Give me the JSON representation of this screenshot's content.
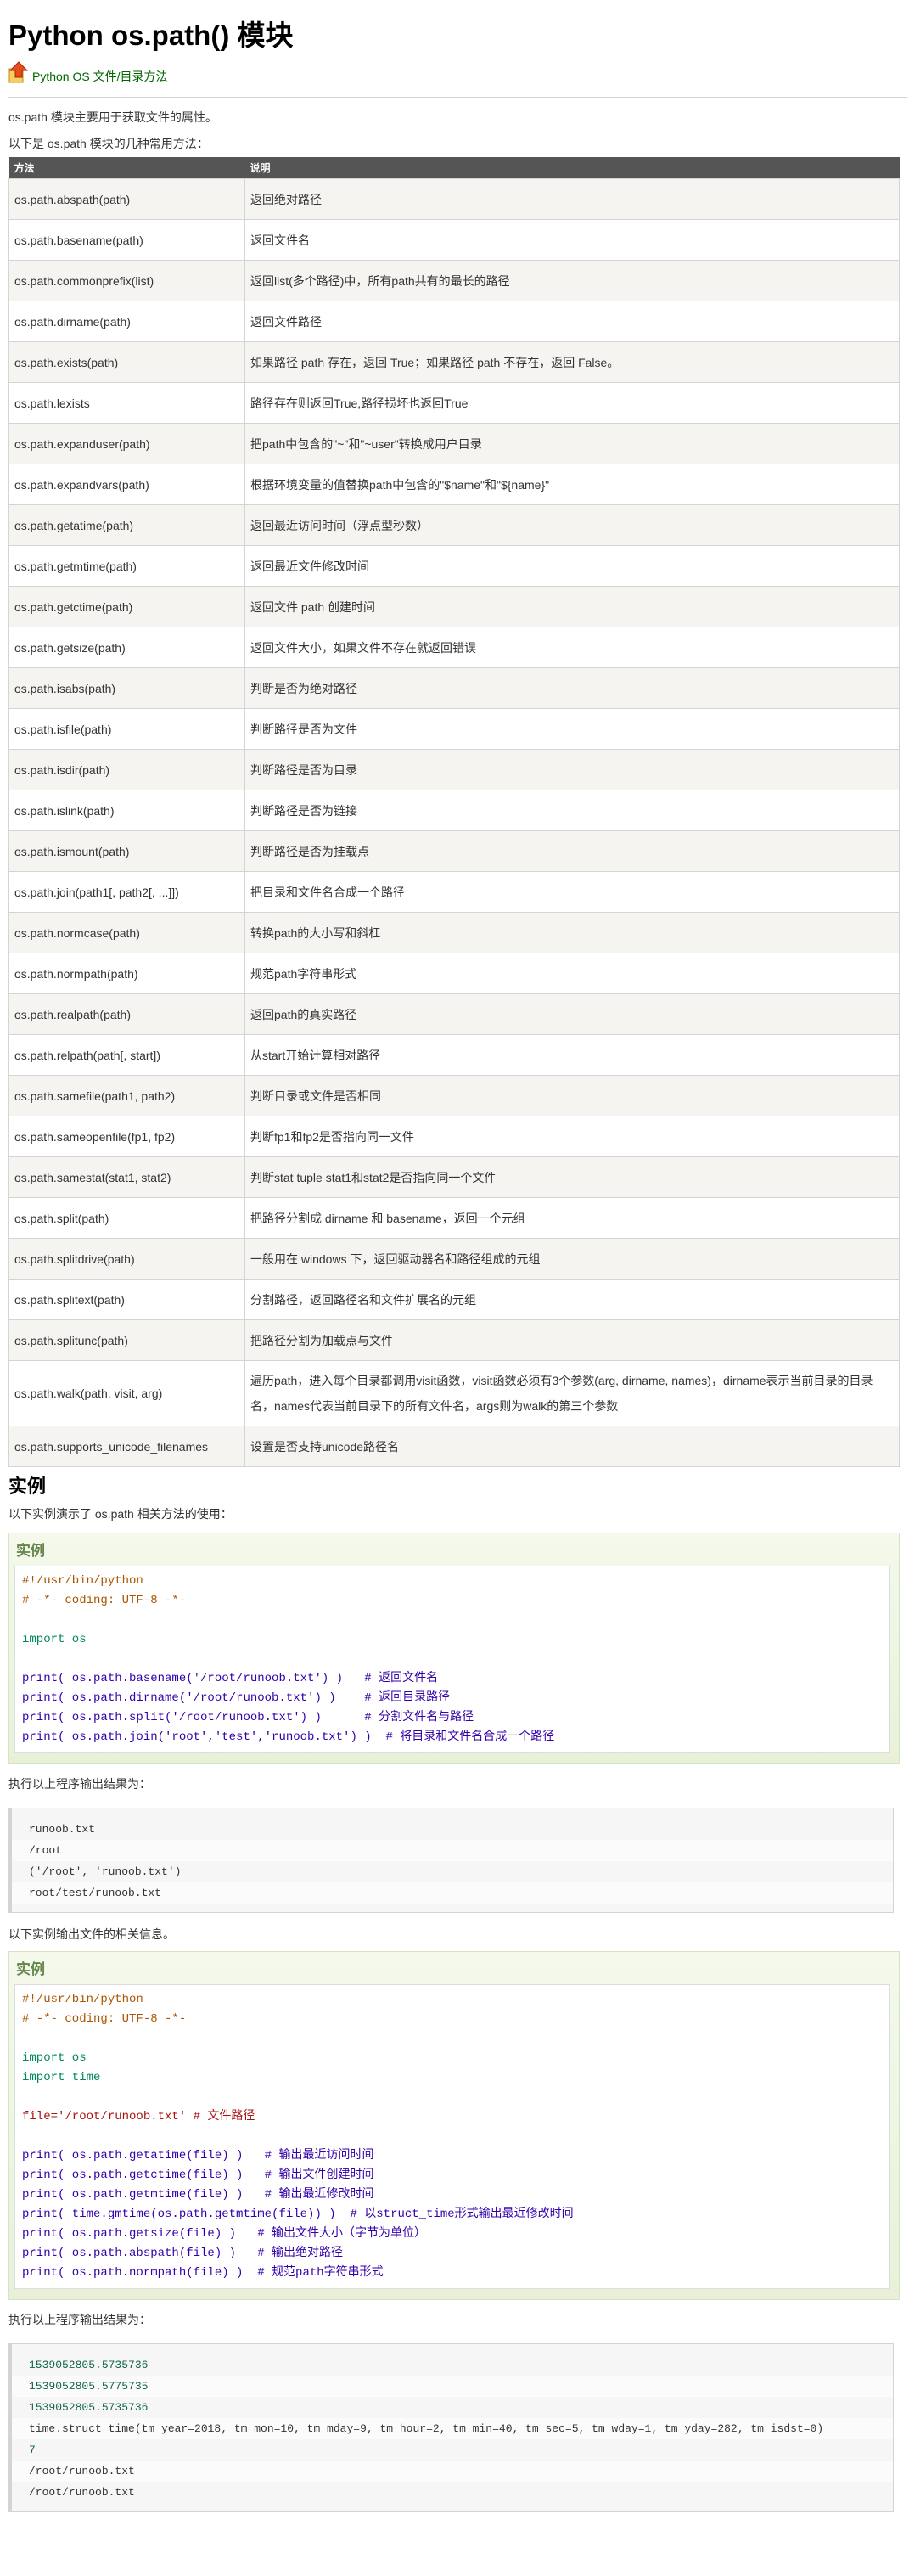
{
  "title": "Python os.path() 模块",
  "back_link": "Python OS 文件/目录方法",
  "intro1": "os.path 模块主要用于获取文件的属性。",
  "intro2": "以下是 os.path 模块的几种常用方法：",
  "table": {
    "headers": [
      "方法",
      "说明"
    ],
    "rows": [
      [
        "os.path.abspath(path)",
        "返回绝对路径"
      ],
      [
        "os.path.basename(path)",
        "返回文件名"
      ],
      [
        "os.path.commonprefix(list)",
        "返回list(多个路径)中，所有path共有的最长的路径"
      ],
      [
        "os.path.dirname(path)",
        "返回文件路径"
      ],
      [
        "os.path.exists(path)",
        "如果路径 path 存在，返回 True；如果路径 path 不存在，返回 False。"
      ],
      [
        "os.path.lexists",
        "路径存在则返回True,路径损坏也返回True"
      ],
      [
        "os.path.expanduser(path)",
        "把path中包含的\"~\"和\"~user\"转换成用户目录"
      ],
      [
        "os.path.expandvars(path)",
        "根据环境变量的值替换path中包含的\"$name\"和\"${name}\""
      ],
      [
        "os.path.getatime(path)",
        "返回最近访问时间（浮点型秒数）"
      ],
      [
        "os.path.getmtime(path)",
        "返回最近文件修改时间"
      ],
      [
        "os.path.getctime(path)",
        "返回文件 path 创建时间"
      ],
      [
        "os.path.getsize(path)",
        "返回文件大小，如果文件不存在就返回错误"
      ],
      [
        "os.path.isabs(path)",
        "判断是否为绝对路径"
      ],
      [
        "os.path.isfile(path)",
        "判断路径是否为文件"
      ],
      [
        "os.path.isdir(path)",
        "判断路径是否为目录"
      ],
      [
        "os.path.islink(path)",
        "判断路径是否为链接"
      ],
      [
        "os.path.ismount(path)",
        "判断路径是否为挂载点"
      ],
      [
        "os.path.join(path1[, path2[, ...]])",
        "把目录和文件名合成一个路径"
      ],
      [
        "os.path.normcase(path)",
        "转换path的大小写和斜杠"
      ],
      [
        "os.path.normpath(path)",
        "规范path字符串形式"
      ],
      [
        "os.path.realpath(path)",
        "返回path的真实路径"
      ],
      [
        "os.path.relpath(path[, start])",
        "从start开始计算相对路径"
      ],
      [
        "os.path.samefile(path1, path2)",
        "判断目录或文件是否相同"
      ],
      [
        "os.path.sameopenfile(fp1, fp2)",
        "判断fp1和fp2是否指向同一文件"
      ],
      [
        "os.path.samestat(stat1, stat2)",
        "判断stat tuple stat1和stat2是否指向同一个文件"
      ],
      [
        "os.path.split(path)",
        "把路径分割成 dirname 和 basename，返回一个元组"
      ],
      [
        "os.path.splitdrive(path)",
        "一般用在 windows 下，返回驱动器名和路径组成的元组"
      ],
      [
        "os.path.splitext(path)",
        "分割路径，返回路径名和文件扩展名的元组"
      ],
      [
        "os.path.splitunc(path)",
        "把路径分割为加载点与文件"
      ],
      [
        "os.path.walk(path, visit, arg)",
        "遍历path，进入每个目录都调用visit函数，visit函数必须有3个参数(arg, dirname, names)，dirname表示当前目录的目录名，names代表当前目录下的所有文件名，args则为walk的第三个参数"
      ],
      [
        "os.path.supports_unicode_filenames",
        "设置是否支持unicode路径名"
      ]
    ]
  },
  "section_title": "实例",
  "example1_intro": "以下实例演示了 os.path 相关方法的使用：",
  "example_label": "实例",
  "example1_lines": [
    "#!/usr/bin/python",
    "# -*- coding: UTF-8 -*-",
    "",
    "import os",
    "",
    "print( os.path.basename('/root/runoob.txt') )   # 返回文件名",
    "print( os.path.dirname('/root/runoob.txt') )    # 返回目录路径",
    "print( os.path.split('/root/runoob.txt') )      # 分割文件名与路径",
    "print( os.path.join('root','test','runoob.txt') )  # 将目录和文件名合成一个路径"
  ],
  "output_intro": "执行以上程序输出结果为：",
  "output1_lines": [
    "runoob.txt",
    "/root",
    "('/root', 'runoob.txt')",
    "root/test/runoob.txt"
  ],
  "example2_intro": "以下实例输出文件的相关信息。",
  "example2_lines": [
    "#!/usr/bin/python",
    "# -*- coding: UTF-8 -*-",
    "",
    "import os",
    "import time",
    "",
    "file='/root/runoob.txt' # 文件路径",
    "",
    "print( os.path.getatime(file) )   # 输出最近访问时间",
    "print( os.path.getctime(file) )   # 输出文件创建时间",
    "print( os.path.getmtime(file) )   # 输出最近修改时间",
    "print( time.gmtime(os.path.getmtime(file)) )  # 以struct_time形式输出最近修改时间",
    "print( os.path.getsize(file) )   # 输出文件大小（字节为单位）",
    "print( os.path.abspath(file) )   # 输出绝对路径",
    "print( os.path.normpath(file) )  # 规范path字符串形式"
  ],
  "output2_intro": "执行以上程序输出结果为：",
  "output2_lines": [
    "1539052805.5735736",
    "1539052805.5775735",
    "1539052805.5735736",
    "time.struct_time(tm_year=2018, tm_mon=10, tm_mday=9, tm_hour=2, tm_min=40, tm_sec=5, tm_wday=1, tm_yday=282, tm_isdst=0)",
    "7",
    "/root/runoob.txt",
    "/root/runoob.txt"
  ]
}
